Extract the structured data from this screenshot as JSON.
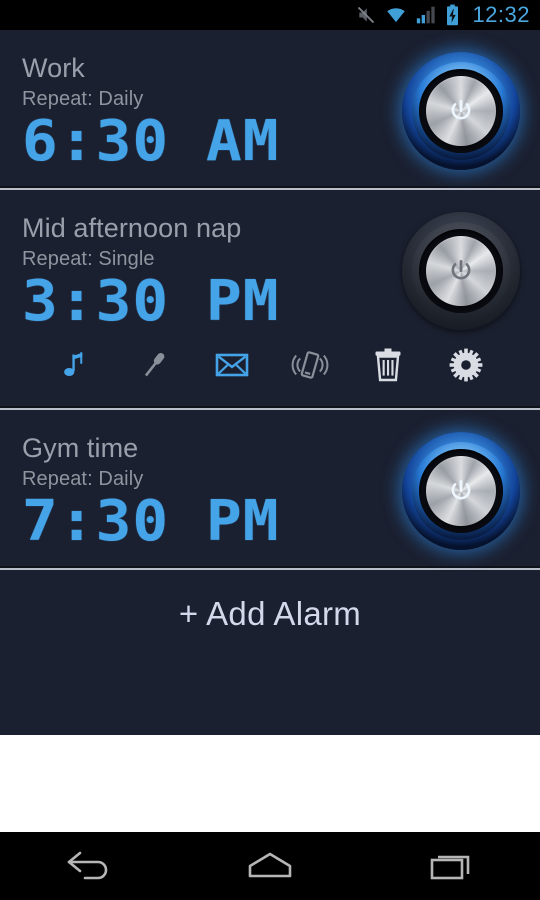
{
  "status_bar": {
    "time": "12:32",
    "icons": [
      "mute-icon",
      "wifi-icon",
      "signal-icon",
      "battery-charging-icon"
    ],
    "clock_color": "#4aa8e0"
  },
  "app": {
    "background_color": "#1b2030",
    "accent_color": "#45a3e8",
    "alarms": [
      {
        "label": "Work",
        "repeat": "Repeat: Daily",
        "time": "6:30 AM",
        "enabled": true,
        "toggle_state": "on",
        "expanded": false
      },
      {
        "label": "Mid afternoon nap",
        "repeat": "Repeat: Single",
        "time": "3:30 PM",
        "enabled": false,
        "toggle_state": "off",
        "expanded": true,
        "actions": [
          {
            "name": "music-note-icon",
            "label": "Ringtone",
            "color": "#45a3e8"
          },
          {
            "name": "microphone-icon",
            "label": "Voice recording",
            "color": "#8b8f99"
          },
          {
            "name": "envelope-icon",
            "label": "Message",
            "color": "#45a3e8"
          },
          {
            "name": "vibrate-icon",
            "label": "Vibrate",
            "color": "#8b8f99"
          },
          {
            "name": "trash-icon",
            "label": "Delete alarm",
            "color": "#d9dce2"
          },
          {
            "name": "gear-icon",
            "label": "Settings",
            "color": "#d9dce2"
          }
        ]
      },
      {
        "label": "Gym time",
        "repeat": "Repeat: Daily",
        "time": "7:30 PM",
        "enabled": true,
        "toggle_state": "on",
        "expanded": false
      }
    ],
    "add_alarm_label": "+ Add Alarm"
  },
  "nav_bar": {
    "buttons": [
      {
        "name": "back-button",
        "label": "Back"
      },
      {
        "name": "home-button",
        "label": "Home"
      },
      {
        "name": "recents-button",
        "label": "Recent apps"
      }
    ]
  }
}
